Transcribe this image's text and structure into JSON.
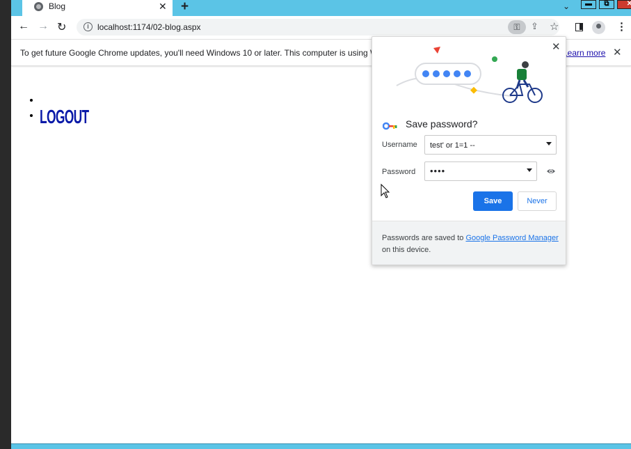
{
  "window": {
    "tab_title": "Blog",
    "tab_close": "✕",
    "new_tab": "+",
    "tab_search": "⌄",
    "minimize": "▬",
    "maximize": "⧉",
    "close": "✕"
  },
  "toolbar": {
    "url": "localhost:1174/02-blog.aspx",
    "icons": [
      "back-arrow-icon",
      "forward-arrow-icon",
      "reload-icon",
      "site-info-icon",
      "password-key-icon",
      "share-icon",
      "bookmark-star-icon",
      "side-panel-icon",
      "profile-icon",
      "menu-icon"
    ]
  },
  "infobar": {
    "message": "To get future Google Chrome updates, you'll need Windows 10 or later. This computer is using Windows",
    "link": "Learn more",
    "close": "✕"
  },
  "page": {
    "list_items": [
      "",
      "LOGOUT"
    ]
  },
  "password_bubble": {
    "title": "Save password?",
    "username_label": "Username",
    "username_value": "test' or 1=1 --",
    "password_label": "Password",
    "password_value": "••••",
    "save_button": "Save",
    "never_button": "Never",
    "footer_prefix": "Passwords are saved to ",
    "footer_link": "Google Password Manager",
    "footer_suffix": " on this device.",
    "close": "✕"
  },
  "colors": {
    "tabstrip": "#5bc4e6",
    "accent": "#1a73e8",
    "logout": "#0a1aa8",
    "window_close": "#cc3b2f"
  }
}
